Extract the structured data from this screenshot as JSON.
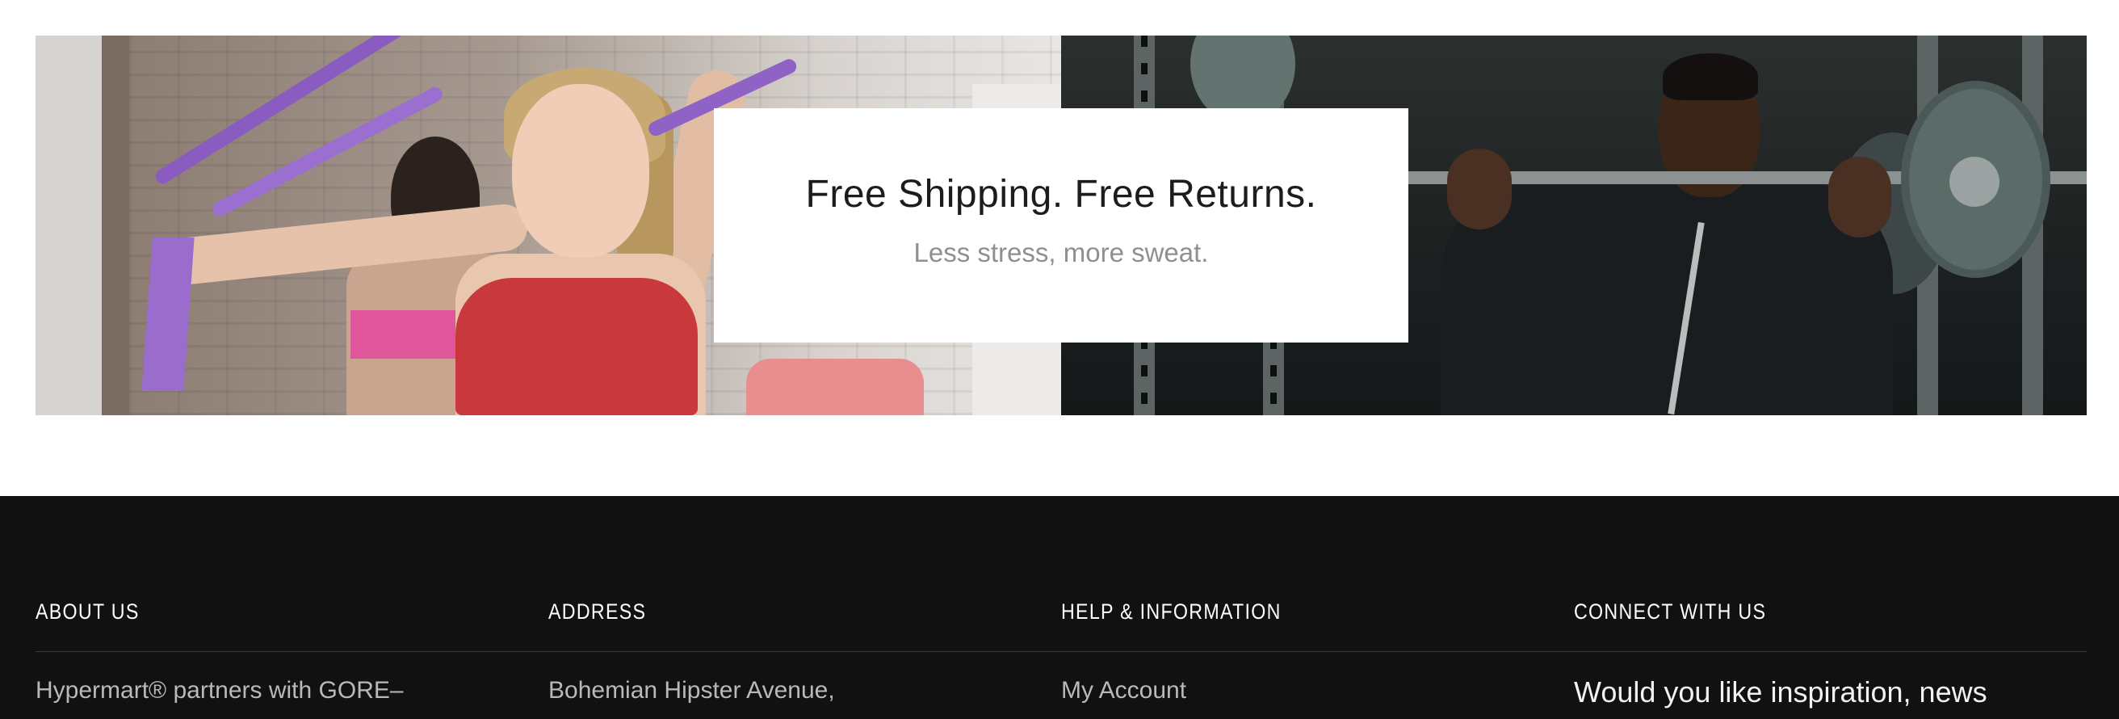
{
  "promo": {
    "title": "Free Shipping. Free Returns.",
    "subtitle": "Less stress, more sweat."
  },
  "footer": {
    "background_color": "#111111",
    "columns": [
      {
        "heading": "ABOUT US",
        "text": "Hypermart® partners with GORE–"
      },
      {
        "heading": "ADDRESS",
        "text": "Bohemian Hipster Avenue,"
      },
      {
        "heading": "HELP & INFORMATION",
        "text": "My Account"
      },
      {
        "heading": "CONNECT WITH US",
        "text": "Would you like inspiration, news"
      }
    ]
  }
}
